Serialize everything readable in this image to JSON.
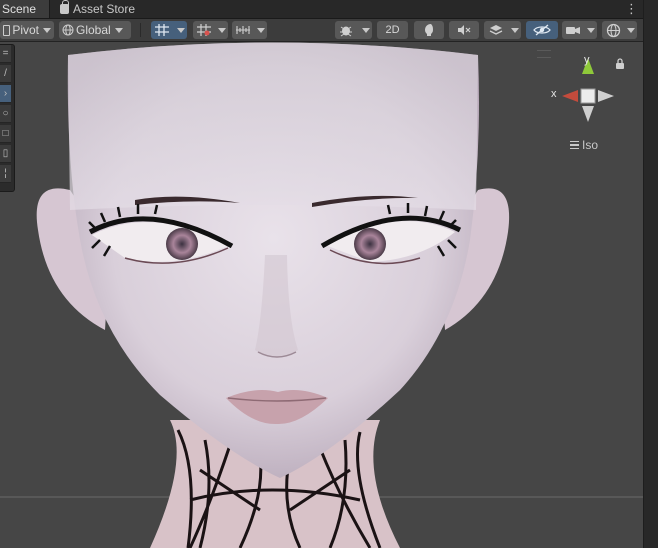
{
  "tabs": [
    {
      "label": "Scene",
      "active": true
    },
    {
      "label": "Asset Store",
      "active": false
    }
  ],
  "tab_menu_icon": "kebab-menu-icon",
  "toolbar": {
    "pivot_label": "Pivot",
    "global_label": "Global",
    "mode_2d_label": "2D"
  },
  "gizmo": {
    "x_label": "x",
    "y_label": "y",
    "projection_label": "Iso"
  },
  "colors": {
    "active_blue": "#46607c",
    "gizmo_x": "#c44b3c",
    "gizmo_y": "#8fc93a"
  },
  "icons": {
    "grid_snap": "grid-snap-icon",
    "increment_snap": "increment-snap-icon",
    "vertex_snap": "ruler-icon",
    "draw_mode": "draw-mode-icon",
    "lighting": "lighting-icon",
    "audio": "audio-mute-icon",
    "effects": "effects-layers-icon",
    "visibility": "hidden-eye-icon",
    "camera": "camera-icon",
    "gizmos": "gizmos-icon"
  }
}
